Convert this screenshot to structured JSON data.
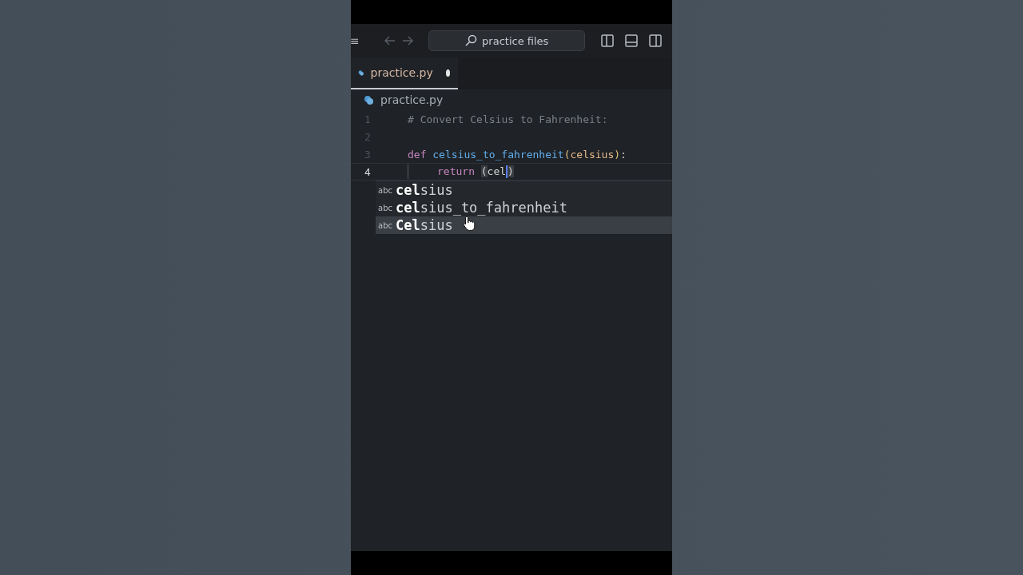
{
  "title_bar": {
    "menu_icon": "≡",
    "search": {
      "value": "practice files"
    }
  },
  "tabs": [
    {
      "label": "practice.py",
      "selected": true,
      "modified": true
    }
  ],
  "breadcrumb": "practice.py",
  "code_lines": [
    {
      "number": "1",
      "current": false,
      "tokens": [
        {
          "kind": "comment",
          "text": "# Convert Celsius to Fahrenheit:"
        }
      ]
    },
    {
      "number": "2",
      "current": false
    },
    {
      "number": "3",
      "current": false,
      "tokens": [
        {
          "kind": "keyword",
          "text": "def"
        },
        {
          "kind": "function",
          "text": "celsius_to_fahrenheit"
        },
        {
          "kind": "paren",
          "text": "("
        },
        {
          "kind": "param",
          "text": "celsius"
        },
        {
          "kind": "paren",
          "text": ")"
        },
        {
          "kind": "plain",
          "text": ":"
        }
      ]
    },
    {
      "number": "4",
      "current": true,
      "tokens": [
        {
          "kind": "indent"
        },
        {
          "kind": "keyword",
          "text": "return"
        },
        {
          "kind": "bracket",
          "text": "("
        },
        {
          "kind": "plain",
          "text": "cel"
        },
        {
          "kind": "cursor"
        },
        {
          "kind": "bracket",
          "text": ")"
        }
      ]
    }
  ],
  "suggestions": [
    {
      "icon": "abc",
      "match": "cel",
      "rest": "sius",
      "selected": false
    },
    {
      "icon": "abc",
      "match": "cel",
      "rest": "sius_to_fahrenheit",
      "selected": false
    },
    {
      "icon": "abc",
      "match": "Cel",
      "rest": "sius",
      "selected": true
    }
  ]
}
